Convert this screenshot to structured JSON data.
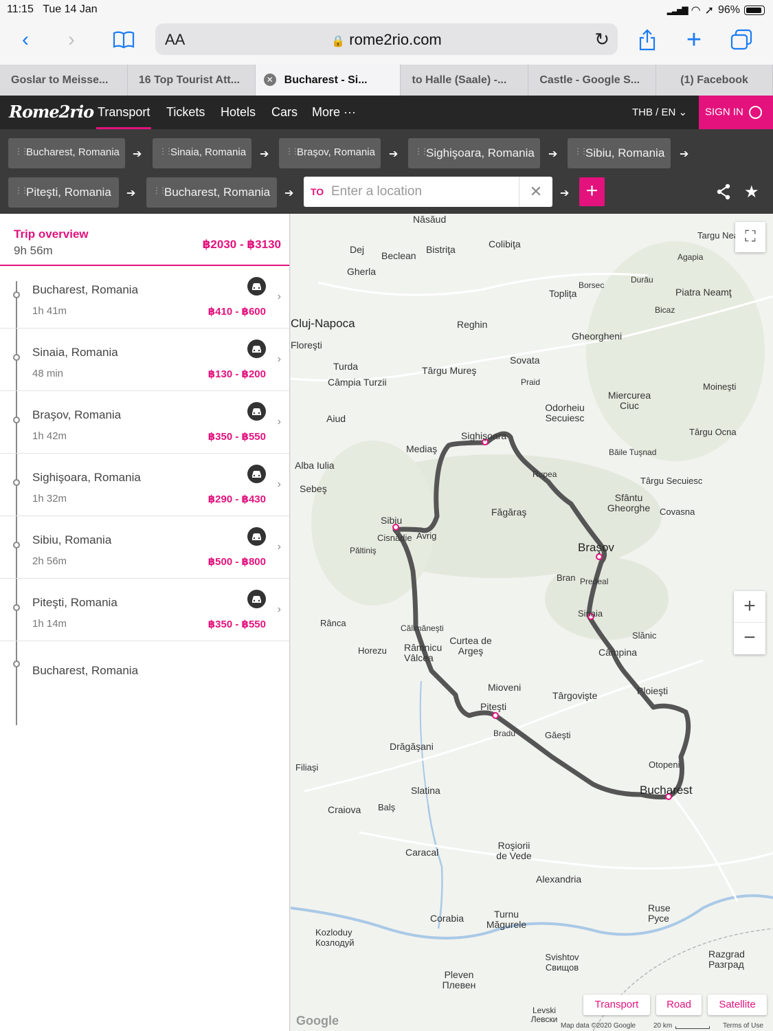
{
  "status_bar": {
    "time": "11:15",
    "date": "Tue 14 Jan",
    "battery": "96%"
  },
  "browser": {
    "aa_label": "AA",
    "url": "rome2rio.com",
    "tabs": [
      {
        "label": "Goslar to Meisse..."
      },
      {
        "label": "16 Top Tourist Att..."
      },
      {
        "label": "Bucharest - Si..."
      },
      {
        "label": "to Halle (Saale) -..."
      },
      {
        "label": "Castle - Google S..."
      },
      {
        "label": "(1) Facebook"
      }
    ]
  },
  "header": {
    "logo": "Rome2rio",
    "nav": [
      "Transport",
      "Tickets",
      "Hotels",
      "Cars",
      "More ···"
    ],
    "currency": "THB / EN",
    "sign_in": "SIGN IN"
  },
  "route": {
    "stops": [
      "Bucharest, Romania",
      "Sinaia, Romania",
      "Braşov, Romania",
      "Sighişoara, Romania",
      "Sibiu, Romania",
      "Piteşti, Romania",
      "Bucharest, Romania"
    ],
    "to_label": "TO",
    "to_placeholder": "Enter a location"
  },
  "trip": {
    "title": "Trip overview",
    "duration": "9h 56m",
    "price": "฿2030 - ฿3130",
    "legs": [
      {
        "name": "Bucharest, Romania",
        "duration": "1h 41m",
        "price": "฿410 - ฿600"
      },
      {
        "name": "Sinaia, Romania",
        "duration": "48 min",
        "price": "฿130 - ฿200"
      },
      {
        "name": "Braşov, Romania",
        "duration": "1h 42m",
        "price": "฿350 - ฿550"
      },
      {
        "name": "Sighişoara, Romania",
        "duration": "1h 32m",
        "price": "฿290 - ฿430"
      },
      {
        "name": "Sibiu, Romania",
        "duration": "2h 56m",
        "price": "฿500 - ฿800"
      },
      {
        "name": "Piteşti, Romania",
        "duration": "1h 14m",
        "price": "฿350 - ฿550"
      }
    ],
    "final_stop": "Bucharest, Romania"
  },
  "map": {
    "cities": [
      "Năsăud",
      "Bistriţa",
      "Colibiţa",
      "Dej",
      "Beclean",
      "Gherla",
      "Cluj-Napoca",
      "Floreşti",
      "Turda",
      "Câmpia Turzii",
      "Reghin",
      "Târgu Mureş",
      "Toplița",
      "Borsec",
      "Gheorgheni",
      "Sovata",
      "Praid",
      "Odorheiu Secuiesc",
      "Miercurea Ciuc",
      "Sighişoara",
      "Mediaş",
      "Aiud",
      "Alba Iulia",
      "Sebeş",
      "Sibiu",
      "Cisnădie",
      "Avrig",
      "Păltiniş",
      "Făgăraş",
      "Rupea",
      "Braşov",
      "Bran",
      "Predeal",
      "Sinaia",
      "Sfântu Gheorghe",
      "Covasna",
      "Târgu Secuiesc",
      "Băile Tuşnad",
      "Târgu Ocna",
      "Câmpina",
      "Slănic",
      "Ploieşti",
      "Călimăneşti",
      "Râmnicu Vâlcea",
      "Curtea de Argeş",
      "Horezu",
      "Rânca",
      "Mioveni",
      "Piteşti",
      "Târgovişte",
      "Găeşti",
      "Bradu",
      "Drăgăşani",
      "Slatina",
      "Balş",
      "Craiova",
      "Caracal",
      "Roşiorii de Vede",
      "Alexandria",
      "Bucharest",
      "Otopeni",
      "Corabia",
      "Turnu Măgurele",
      "Svishtov Свищов",
      "Pleven Плевен",
      "Ruse Русе",
      "Razgrad Разград",
      "Kozloduy Козлодуй",
      "Targu Neamţ",
      "Agapia",
      "Piatra Neamţ",
      "Bicaz",
      "Durău",
      "Moineşti",
      "Filiaşi",
      "Levski Левски"
    ],
    "map_types": [
      "Transport",
      "Road",
      "Satellite"
    ],
    "attribution": "Map data ©2020 Google",
    "scale": "20 km",
    "terms": "Terms of Use",
    "zoom_in": "+",
    "zoom_out": "−",
    "google": "Google"
  }
}
